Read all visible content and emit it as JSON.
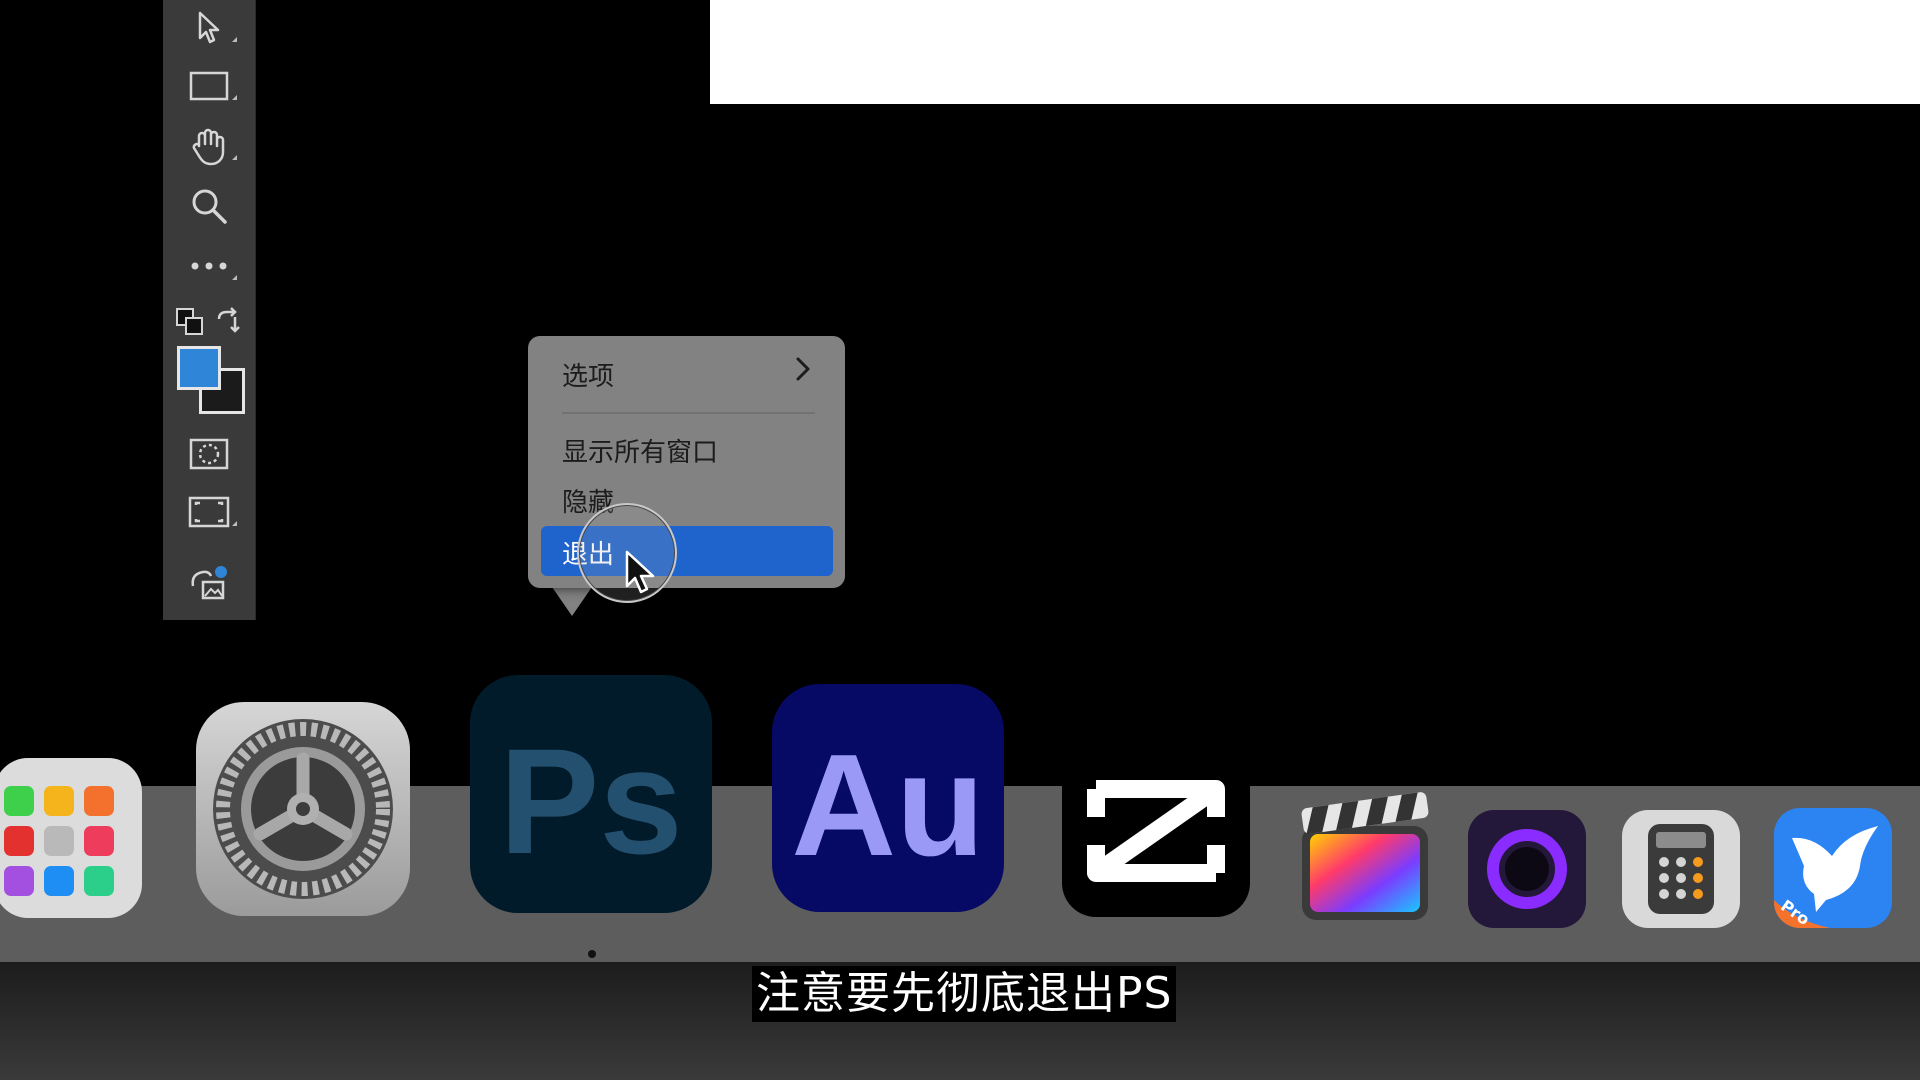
{
  "context_menu": {
    "items": [
      {
        "label": "选项"
      },
      {
        "label": "显示所有窗口"
      },
      {
        "label": "隐藏"
      },
      {
        "label": "退出"
      }
    ]
  },
  "dock": {
    "photoshop_label": "Ps",
    "audition_label": "Au",
    "calculator_icon": "calculator-icon",
    "bird_badge": "Pro"
  },
  "subtitle": "注意要先彻底退出PS",
  "colors": {
    "menu_highlight": "#1f63cc",
    "foreground_swatch": "#2f86d8",
    "menu_bg": "#828282"
  }
}
